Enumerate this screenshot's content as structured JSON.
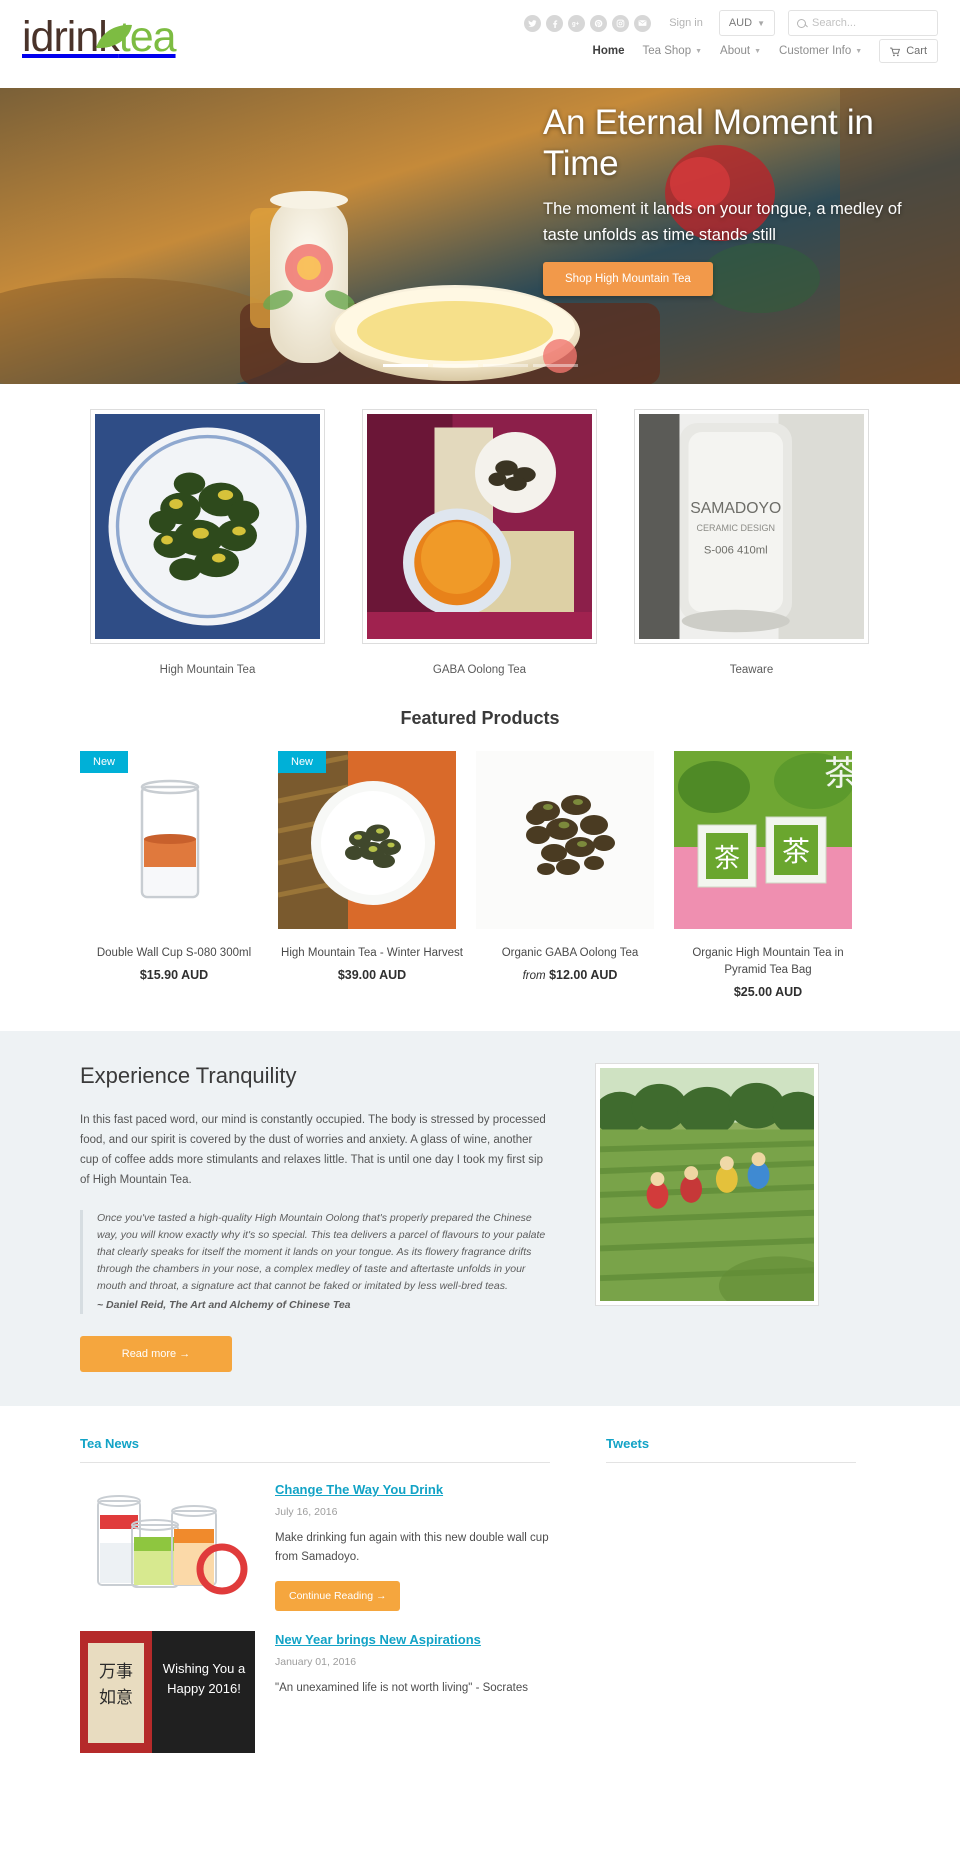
{
  "header": {
    "logo": {
      "part1": "idrink",
      "part2": "tea"
    },
    "social": [
      {
        "name": "twitter-icon",
        "glyph": "t"
      },
      {
        "name": "facebook-icon",
        "glyph": "f"
      },
      {
        "name": "google-plus-icon",
        "glyph": "g+"
      },
      {
        "name": "pinterest-icon",
        "glyph": "P"
      },
      {
        "name": "instagram-icon",
        "glyph": "◙"
      },
      {
        "name": "email-icon",
        "glyph": "✉"
      }
    ],
    "signin": "Sign in",
    "currency": "AUD",
    "search_placeholder": "Search...",
    "search_value": "",
    "nav": [
      {
        "label": "Home",
        "caret": false,
        "active": true
      },
      {
        "label": "Tea Shop",
        "caret": true,
        "active": false
      },
      {
        "label": "About",
        "caret": true,
        "active": false
      },
      {
        "label": "Customer Info",
        "caret": true,
        "active": false
      }
    ],
    "cart_label": "Cart"
  },
  "hero": {
    "title": "An Eternal Moment in Time",
    "subtitle": "The moment it lands on your tongue, a medley of taste unfolds as time stands still",
    "button": "Shop High Mountain Tea",
    "slides": 4,
    "active_slide": 1
  },
  "categories": [
    {
      "label": "High Mountain Tea"
    },
    {
      "label": "GABA Oolong Tea"
    },
    {
      "label": "Teaware"
    }
  ],
  "featured": {
    "heading": "Featured Products",
    "products": [
      {
        "name": "Double Wall Cup S-080 300ml",
        "price": "$15.90 AUD",
        "from": "",
        "badge": "New"
      },
      {
        "name": "High Mountain Tea - Winter Harvest",
        "price": "$39.00 AUD",
        "from": "",
        "badge": "New"
      },
      {
        "name": "Organic GABA Oolong Tea",
        "price": "$12.00 AUD",
        "from": "from",
        "badge": ""
      },
      {
        "name": "Organic High Mountain Tea in Pyramid Tea Bag",
        "price": "$25.00 AUD",
        "from": "",
        "badge": ""
      }
    ]
  },
  "tranquility": {
    "heading": "Experience Tranquility",
    "paragraph": "In this fast paced word, our mind is constantly occupied. The body is stressed by processed food, and our spirit is covered by the dust of worries and anxiety. A glass of wine, another cup of coffee adds more stimulants and relaxes little. That is until one day I took my first sip of High Mountain Tea.",
    "quote": "Once you've tasted a high-quality High Mountain Oolong that's properly prepared the Chinese way, you will know exactly why it's so special. This tea delivers a parcel of flavours to your palate that clearly speaks for itself the moment it lands on your tongue. As its flowery fragrance drifts through the chambers in your nose, a complex medley of taste and aftertaste unfolds in your mouth and throat, a signature act that cannot be faked or imitated by less well-bred teas.",
    "cite": "~ Daniel Reid, The Art and Alchemy of Chinese Tea",
    "button": "Read more →"
  },
  "news": {
    "heading": "Tea News",
    "tweets_heading": "Tweets",
    "articles": [
      {
        "title": "Change The Way You Drink",
        "date": "July 16, 2016",
        "excerpt": "Make drinking fun again with this new double wall cup from Samadoyo.",
        "button": "Continue Reading →"
      },
      {
        "title": "New Year brings New Aspirations",
        "date": "January 01, 2016",
        "excerpt": "\"An unexamined life is not worth living\" - Socrates",
        "button": ""
      }
    ]
  },
  "colors": {
    "brand_green": "#7dbc42",
    "brand_brown": "#4a332a",
    "accent_orange": "#f5a63e",
    "link_blue": "#12a3c6",
    "badge_blue": "#00b0d7"
  }
}
